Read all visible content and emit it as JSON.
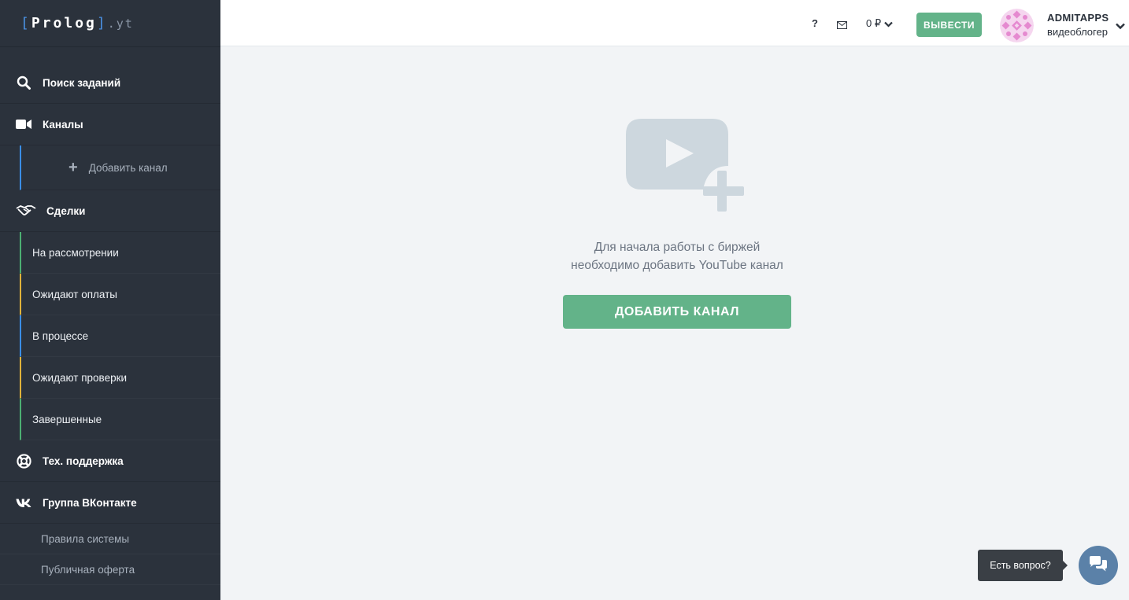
{
  "logo": {
    "open": "[",
    "word": "Prolog",
    "close": "]",
    "suffix": ".yt"
  },
  "sidebar": {
    "search": "Поиск заданий",
    "channels": "Каналы",
    "add_channel": "Добавить канал",
    "deals": "Сделки",
    "deal_items": [
      {
        "label": "На рассмотрении",
        "accent": "#4caf72"
      },
      {
        "label": "Ожидают оплаты",
        "accent": "#e0b23a"
      },
      {
        "label": "В процессе",
        "accent": "#3a8ee6"
      },
      {
        "label": "Ожидают проверки",
        "accent": "#e0b23a"
      },
      {
        "label": "Завершенные",
        "accent": "#4caf72"
      }
    ],
    "support": "Тех. поддержка",
    "vk_group": "Группа ВКонтакте",
    "footer_links": [
      "Правила системы",
      "Публичная оферта"
    ]
  },
  "header": {
    "help": "?",
    "balance": "0 ₽",
    "withdraw_label": "ВЫВЕСТИ",
    "username": "ADMITAPPS",
    "role": "видеоблогер"
  },
  "main": {
    "message_line1": "Для начала работы с биржей",
    "message_line2": "необходимо добавить YouTube канал",
    "cta_label": "ДОБАВИТЬ КАНАЛ"
  },
  "chat": {
    "tooltip": "Есть вопрос?"
  },
  "colors": {
    "sidebar_bg": "#2b323c",
    "accent_green": "#63b389",
    "chat_blue": "#5b81a8"
  },
  "icons": [
    "search-icon",
    "video-camera-icon",
    "plus-icon",
    "handshake-icon",
    "lifebuoy-icon",
    "vk-icon",
    "mail-icon",
    "chevron-down-icon",
    "chat-icon"
  ]
}
